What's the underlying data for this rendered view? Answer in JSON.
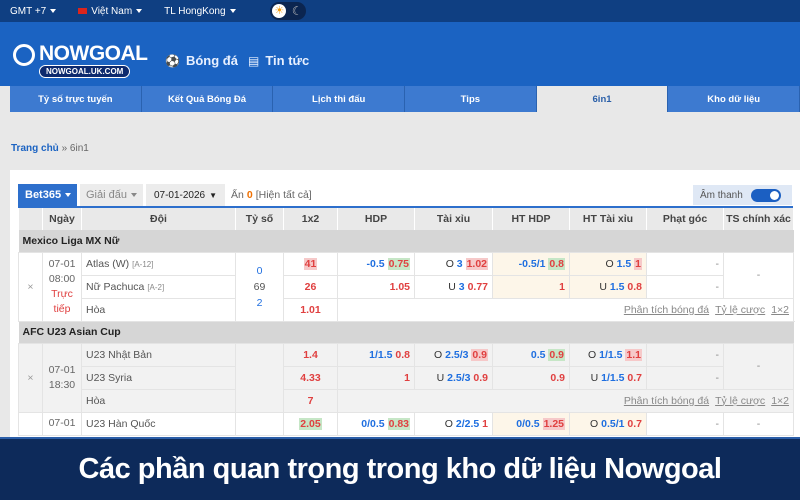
{
  "topbar": {
    "timezone": "GMT +7",
    "language": "Việt Nam",
    "odds_company": "TL HongKong"
  },
  "header": {
    "logo_name": "NOWGOAL",
    "logo_url": "NOWGOAL.UK.COM",
    "nav": [
      {
        "label": "Bóng đá",
        "icon": "soccer-ball-icon"
      },
      {
        "label": "Tin tức",
        "icon": "news-icon"
      }
    ]
  },
  "tabs": [
    {
      "label": "Tỷ số trực tuyến"
    },
    {
      "label": "Kết Quả Bóng Đá"
    },
    {
      "label": "Lịch thi đấu"
    },
    {
      "label": "Tips"
    },
    {
      "label": "6in1",
      "active": true
    },
    {
      "label": "Kho dữ liệu"
    }
  ],
  "breadcrumb": {
    "home": "Trang chủ",
    "sep": "»",
    "current": "6in1"
  },
  "controls": {
    "bookmaker": "Bet365",
    "league": "Giải đấu",
    "date": "07-01-2026",
    "hidden_label": "Ẩn",
    "hidden_count": "0",
    "show_all": "[Hiện tất cả]",
    "sound": "Âm thanh",
    "sound_on": true
  },
  "columns": [
    "",
    "Ngày",
    "Đội",
    "Tỷ số",
    "1x2",
    "HDP",
    "Tài xỉu",
    "HT HDP",
    "HT Tài xỉu",
    "Phạt góc",
    "TS chính xác"
  ],
  "links": [
    "Phân tích bóng đá",
    "Tỷ lệ cược",
    "1×2"
  ],
  "leagues": [
    {
      "name": "Mexico Liga MX Nữ",
      "matches": [
        {
          "date": "07-01",
          "time": "08:00",
          "status": "Trực tiếp",
          "score_home": "0",
          "minute": "69",
          "score_away": "2",
          "close": "×",
          "draw_label": "Hòa",
          "draw": "1.01",
          "exact": "-",
          "teams": [
            {
              "name": "Atlas (W)",
              "rank": "[A-12]",
              "x12": "41",
              "x12_hl": "red",
              "hdp": "-0.5",
              "hdp_odds": "0.75",
              "hdp_hl": "green",
              "tx_side": "O",
              "tx_line": "3",
              "tx_odds": "1.02",
              "tx_hl": "red",
              "hthdp": "-0.5/1",
              "hthdp_odds": "0.8",
              "hthdp_hl": "green",
              "httx_side": "O",
              "httx_line": "1.5",
              "httx_odds": "1",
              "httx_hl": "red",
              "corner": "-"
            },
            {
              "name": "Nữ Pachuca",
              "rank": "[A-2]",
              "x12": "26",
              "hdp": "",
              "hdp_odds": "1.05",
              "tx_side": "U",
              "tx_line": "3",
              "tx_odds": "0.77",
              "hthdp": "",
              "hthdp_odds": "1",
              "httx_side": "U",
              "httx_line": "1.5",
              "httx_odds": "0.8",
              "corner": "-"
            }
          ]
        }
      ]
    },
    {
      "name": "AFC U23 Asian Cup",
      "matches": [
        {
          "date": "07-01",
          "time": "18:30",
          "status": "",
          "score_home": "",
          "minute": "",
          "score_away": "",
          "close": "×",
          "draw_label": "Hòa",
          "draw": "7",
          "exact": "-",
          "grey": true,
          "teams": [
            {
              "name": "U23 Nhật Bản",
              "rank": "",
              "x12": "1.4",
              "hdp": "1/1.5",
              "hdp_odds": "0.8",
              "tx_side": "O",
              "tx_line": "2.5/3",
              "tx_odds": "0.9",
              "tx_hl": "red",
              "hthdp": "0.5",
              "hthdp_odds": "0.9",
              "hthdp_hl": "green",
              "httx_side": "O",
              "httx_line": "1/1.5",
              "httx_odds": "1.1",
              "httx_hl": "red",
              "corner": "-"
            },
            {
              "name": "U23 Syria",
              "rank": "",
              "x12": "4.33",
              "hdp": "",
              "hdp_odds": "1",
              "tx_side": "U",
              "tx_line": "2.5/3",
              "tx_odds": "0.9",
              "hthdp": "",
              "hthdp_odds": "0.9",
              "httx_side": "U",
              "httx_line": "1/1.5",
              "httx_odds": "0.7",
              "corner": "-"
            }
          ]
        },
        {
          "date": "07-01",
          "time": "",
          "status": "",
          "score_home": "",
          "minute": "",
          "score_away": "",
          "close": "",
          "exact": "-",
          "partial": true,
          "teams": [
            {
              "name": "U23 Hàn Quốc",
              "rank": "",
              "x12": "2.05",
              "x12_hl": "green",
              "hdp": "0/0.5",
              "hdp_odds": "0.83",
              "hdp_hl": "green",
              "tx_side": "O",
              "tx_line": "2/2.5",
              "tx_odds": "1",
              "hthdp": "0/0.5",
              "hthdp_odds": "1.25",
              "hthdp_hl": "red",
              "httx_side": "O",
              "httx_line": "0.5/1",
              "httx_odds": "0.7",
              "corner": "-"
            }
          ]
        }
      ]
    }
  ],
  "banner": "Các phần quan trọng trong kho dữ liệu Nowgoal",
  "colors": {
    "topbar": "#0f3f82",
    "header": "#1b63c2",
    "tab": "#3d7ad0",
    "banner": "#0d2a5a",
    "odds_up_bg": "#f6c9c9",
    "odds_down_bg": "#c6e6c6"
  }
}
